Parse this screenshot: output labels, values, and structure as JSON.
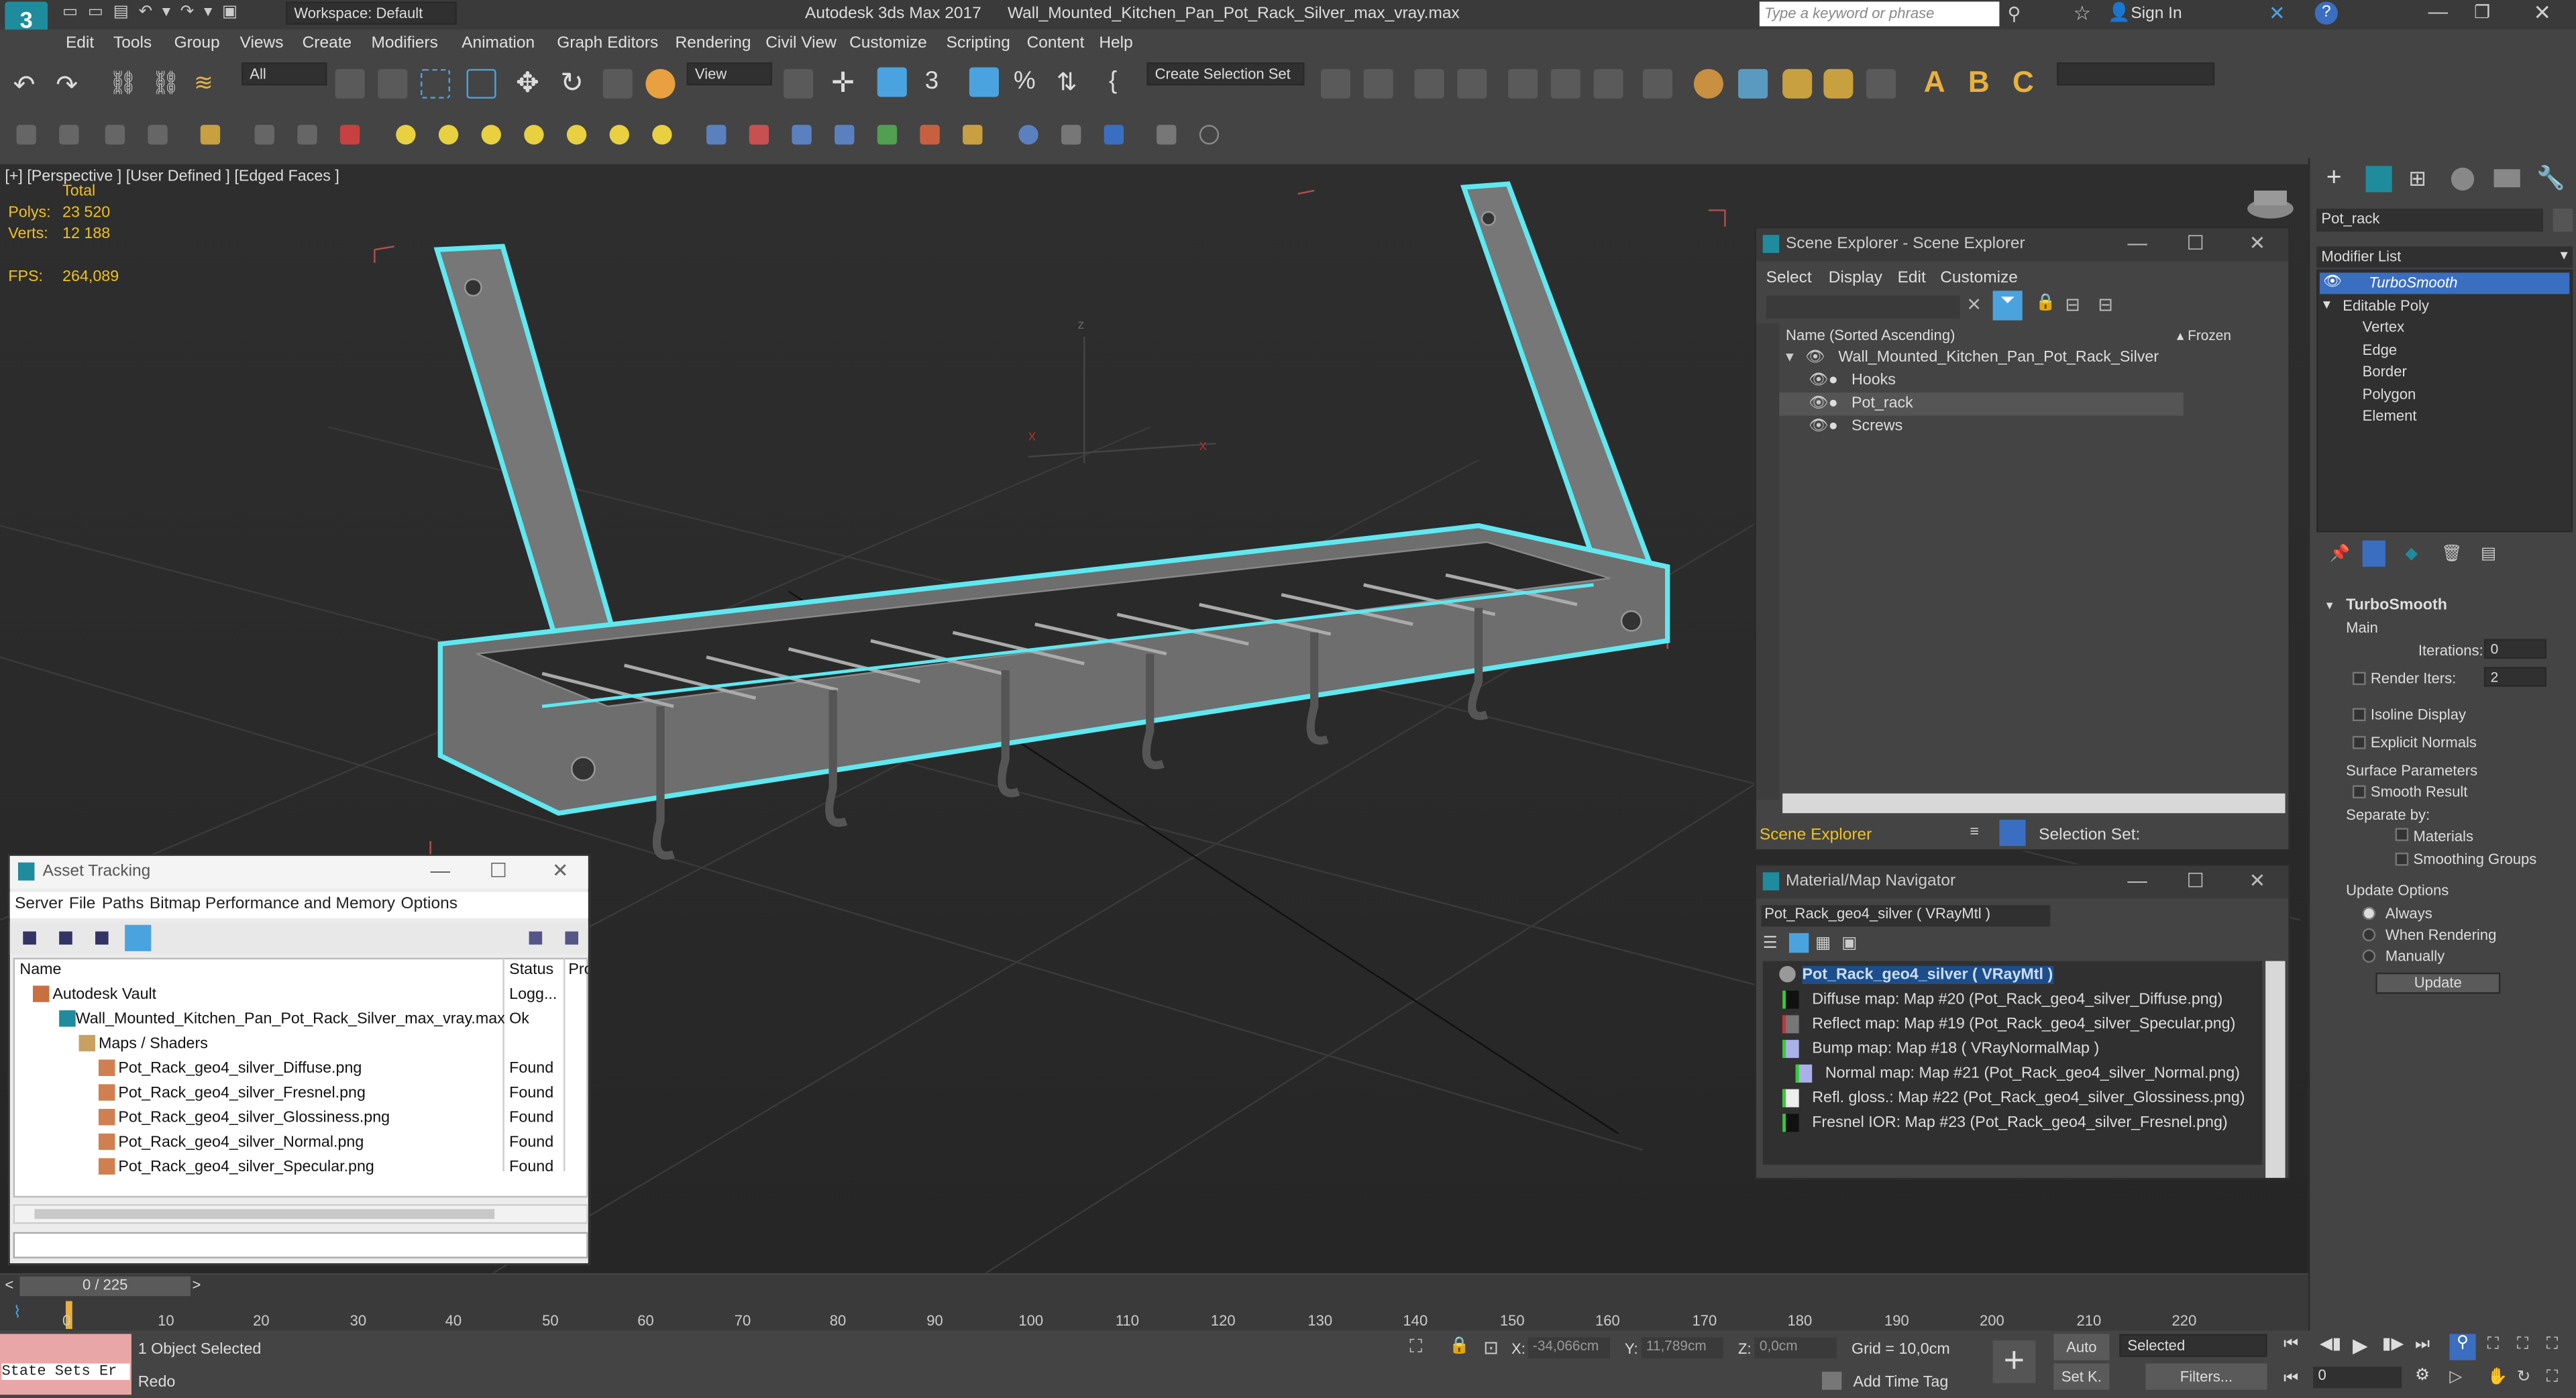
{
  "app": {
    "title": "Autodesk 3ds Max 2017",
    "file": "Wall_Mounted_Kitchen_Pan_Pot_Rack_Silver_max_vray.max",
    "workspace": "Workspace: Default",
    "search_placeholder": "Type a keyword or phrase",
    "sign_in": "Sign In"
  },
  "menu": [
    "Edit",
    "Tools",
    "Group",
    "Views",
    "Create",
    "Modifiers",
    "Animation",
    "Graph Editors",
    "Rendering",
    "Civil View",
    "Customize",
    "Scripting",
    "Content",
    "Help"
  ],
  "toolbar": {
    "filter_value": "All",
    "view_value": "View",
    "selection_set_label": "Create Selection Set"
  },
  "viewport": {
    "label": "[+] [Perspective ] [User Defined ] [Edged Faces ]",
    "stats": {
      "total": "Total",
      "polys_label": "Polys:",
      "polys": "23 520",
      "verts_label": "Verts:",
      "verts": "12 188",
      "fps_label": "FPS:",
      "fps": "264,089"
    }
  },
  "scene_explorer": {
    "title": "Scene Explorer - Scene Explorer",
    "menu": [
      "Select",
      "Display",
      "Edit",
      "Customize"
    ],
    "col_name": "Name (Sorted Ascending)",
    "col_frozen": "▴ Frozen",
    "root": "Wall_Mounted_Kitchen_Pan_Pot_Rack_Silver",
    "children": [
      "Hooks",
      "Pot_rack",
      "Screws"
    ],
    "footer_label": "Scene Explorer",
    "selection_set_label": "Selection Set:"
  },
  "material_nav": {
    "title": "Material/Map Navigator",
    "field": "Pot_Rack_geo4_silver  ( VRayMtl )",
    "root": "Pot_Rack_geo4_silver  ( VRayMtl )",
    "maps": [
      "Diffuse map: Map #20 (Pot_Rack_geo4_silver_Diffuse.png)",
      "Reflect map: Map #19 (Pot_Rack_geo4_silver_Specular.png)",
      "Bump map: Map #18  ( VRayNormalMap )",
      "Normal map: Map #21 (Pot_Rack_geo4_silver_Normal.png)",
      "Refl. gloss.: Map #22 (Pot_Rack_geo4_silver_Glossiness.png)",
      "Fresnel IOR: Map #23 (Pot_Rack_geo4_silver_Fresnel.png)"
    ]
  },
  "asset_tracking": {
    "title": "Asset Tracking",
    "menu": [
      "Server",
      "File",
      "Paths",
      "Bitmap Performance and Memory",
      "Options"
    ],
    "columns": [
      "Name",
      "Status",
      "Pro"
    ],
    "rows": [
      {
        "name": "Autodesk Vault",
        "status": "Logg..."
      },
      {
        "name": "Wall_Mounted_Kitchen_Pan_Pot_Rack_Silver_max_vray.max",
        "status": "Ok"
      },
      {
        "name": "Maps / Shaders",
        "status": ""
      },
      {
        "name": "Pot_Rack_geo4_silver_Diffuse.png",
        "status": "Found"
      },
      {
        "name": "Pot_Rack_geo4_silver_Fresnel.png",
        "status": "Found"
      },
      {
        "name": "Pot_Rack_geo4_silver_Glossiness.png",
        "status": "Found"
      },
      {
        "name": "Pot_Rack_geo4_silver_Normal.png",
        "status": "Found"
      },
      {
        "name": "Pot_Rack_geo4_silver_Specular.png",
        "status": "Found"
      }
    ]
  },
  "command_panel": {
    "object_name": "Pot_rack",
    "modifier_list": "Modifier List",
    "stack": [
      "TurboSmooth",
      "Editable Poly",
      "Vertex",
      "Edge",
      "Border",
      "Polygon",
      "Element"
    ],
    "rollout_title": "TurboSmooth",
    "main": "Main",
    "iterations_label": "Iterations:",
    "iterations": "0",
    "render_iters_label": "Render Iters:",
    "render_iters": "2",
    "isoline": "Isoline Display",
    "explicit_normals": "Explicit Normals",
    "surface_params": "Surface Parameters",
    "smooth_result": "Smooth Result",
    "separate_by": "Separate by:",
    "materials": "Materials",
    "smoothing_groups": "Smoothing Groups",
    "update_options": "Update Options",
    "always": "Always",
    "when_rendering": "When Rendering",
    "manually": "Manually",
    "update_button": "Update"
  },
  "timeline": {
    "frame": "0 / 225",
    "ticks": [
      "0",
      "10",
      "20",
      "30",
      "40",
      "50",
      "60",
      "70",
      "80",
      "90",
      "100",
      "110",
      "120",
      "130",
      "140",
      "150",
      "160",
      "170",
      "180",
      "190",
      "200",
      "210",
      "220"
    ]
  },
  "status": {
    "state_sets": "State Sets Er",
    "selected": "1 Object Selected",
    "prompt": "Redo",
    "x_label": "X:",
    "x": "-34,066cm",
    "y_label": "Y:",
    "y": "11,789cm",
    "z_label": "Z:",
    "z": "0,0cm",
    "grid": "Grid = 10,0cm",
    "add_time_tag": "Add Time Tag",
    "auto": "Auto",
    "set_key": "Set K.",
    "selected_dropdown": "Selected",
    "filters": "Filters...",
    "frame_field": "0"
  },
  "colors": {
    "accent": "#4aa3df",
    "selection": "#5fe8f0",
    "hud": "#f0c020"
  }
}
